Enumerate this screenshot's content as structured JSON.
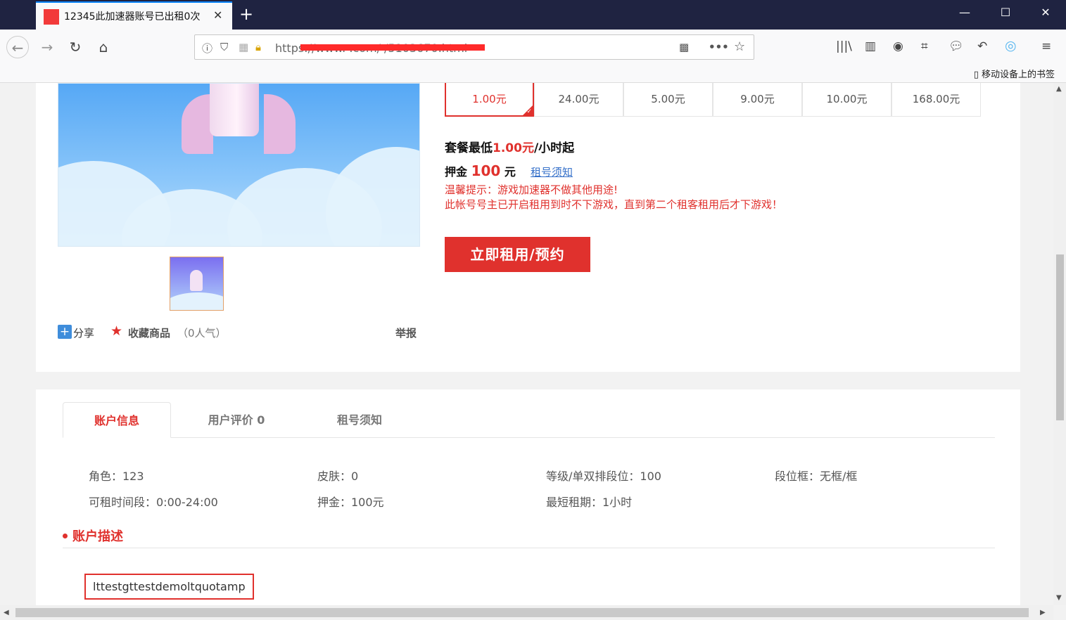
{
  "browser": {
    "tab_title": "12345此加速器账号已出租0次",
    "url": "https://www.          .com/         /5103670.html",
    "mobile_bookmarks": "移动设备上的书签"
  },
  "icons": {
    "back": "back-arrow-icon",
    "forward": "forward-arrow-icon",
    "reload": "reload-icon",
    "home": "home-icon",
    "info": "info-icon",
    "shield": "tracking-shield-icon",
    "lock": "insecure-lock-icon",
    "qr": "qr-code-icon",
    "more": "more-icon",
    "star": "bookmark-star-icon",
    "library": "library-icon",
    "sidebar": "sidebar-icon",
    "account": "account-icon",
    "screenshot": "screenshot-icon",
    "chat": "chat-icon",
    "undo": "undo-icon",
    "extension": "extension-icon",
    "menu": "menu-icon"
  },
  "product": {
    "prices": [
      "1.00元",
      "24.00元",
      "5.00元",
      "9.00元",
      "10.00元",
      "168.00元"
    ],
    "min_price_prefix": "套餐最低",
    "min_price_value": "1.00元",
    "min_price_suffix": "/小时起",
    "deposit_label": "押金",
    "deposit_amount": "100",
    "deposit_unit": "元",
    "rules_link": "租号须知",
    "warning_1": "温馨提示：游戏加速器不做其他用途!",
    "warning_2": "此帐号号主已开启租用到时不下游戏，直到第二个租客租用后才下游戏！",
    "rent_button": "立即租用/预约",
    "share": "分享",
    "favorite": "收藏商品",
    "popularity": "（0人气）",
    "report": "举报"
  },
  "details": {
    "tabs": [
      "账户信息",
      "用户评价 0",
      "租号须知"
    ],
    "info": [
      "角色：123",
      "皮肤：0",
      "等级/单双排段位：100",
      "段位框：无框/框",
      "可租时间段：0:00-24:00",
      "押金：100元",
      "最短租期：1小时"
    ],
    "desc_title": "账户描述",
    "desc_text": "lttestgttestdemoltquotamp"
  },
  "colors": {
    "accent": "#e0312d",
    "link": "#3570c9",
    "titlebar": "#1f2341"
  }
}
